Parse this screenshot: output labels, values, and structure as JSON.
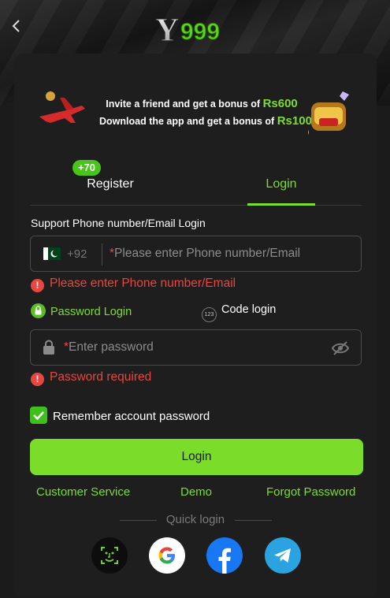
{
  "header": {
    "logo_text": "Y999"
  },
  "banner": {
    "line1_prefix": "Invite a friend and get a bonus of",
    "line1_amount": "Rs600",
    "line2_prefix": "Download the app and get a bonus of",
    "line2_amount": "Rs100"
  },
  "tabs": {
    "register_label": "Register",
    "register_badge": "+70",
    "login_label": "Login",
    "active": "Login"
  },
  "form": {
    "support_label": "Support Phone number/Email Login",
    "country_code": "+92",
    "phone_required_mark": "*",
    "phone_placeholder": "Please enter Phone number/Email",
    "phone_error": "Please enter Phone number/Email",
    "mode_password_label": "Password Login",
    "mode_code_label": "Code login",
    "mode_code_icon_text": "123",
    "password_required_mark": "*",
    "password_placeholder": "Enter password",
    "password_error": "Password required",
    "remember_label": "Remember account password",
    "remember_checked": true,
    "login_button": "Login"
  },
  "links": {
    "customer_service": "Customer Service",
    "demo": "Demo",
    "forgot_password": "Forgot Password"
  },
  "quick_login": {
    "label": "Quick login",
    "providers": [
      "face-id-icon",
      "google-icon",
      "facebook-icon",
      "telegram-icon"
    ]
  },
  "colors": {
    "accent": "#7ddc2c",
    "error": "#e8463f",
    "background": "#1b1b1b",
    "card": "#1e1e1e"
  }
}
